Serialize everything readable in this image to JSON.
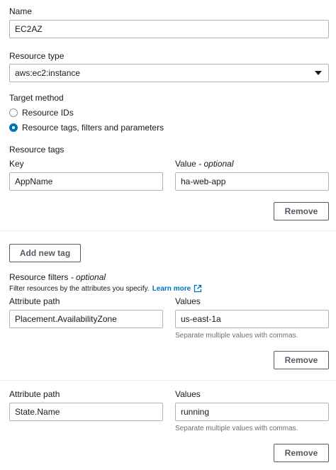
{
  "name_field": {
    "label": "Name",
    "value": "EC2AZ"
  },
  "resource_type": {
    "label": "Resource type",
    "value": "aws:ec2:instance"
  },
  "target_method": {
    "label": "Target method",
    "options": [
      {
        "label": "Resource IDs",
        "selected": false
      },
      {
        "label": "Resource tags, filters and parameters",
        "selected": true
      }
    ]
  },
  "resource_tags": {
    "label": "Resource tags",
    "key_label": "Key",
    "value_label": "Value",
    "value_optional": " - optional",
    "rows": [
      {
        "key": "AppName",
        "value": "ha-web-app"
      }
    ],
    "remove_label": "Remove",
    "add_label": "Add new tag"
  },
  "resource_filters": {
    "label": "Resource filters",
    "optional": " - optional",
    "description": "Filter resources by the attributes you specify.",
    "learn_more": "Learn more",
    "attr_label": "Attribute path",
    "values_label": "Values",
    "hint": "Separate multiple values with commas.",
    "remove_label": "Remove",
    "rows": [
      {
        "attribute": "Placement.AvailabilityZone",
        "values": "us-east-1a"
      },
      {
        "attribute": "State.Name",
        "values": "running"
      }
    ]
  },
  "colors": {
    "accent": "#0073bb",
    "border": "#aab7b8",
    "text": "#16191f",
    "muted": "#687078"
  }
}
